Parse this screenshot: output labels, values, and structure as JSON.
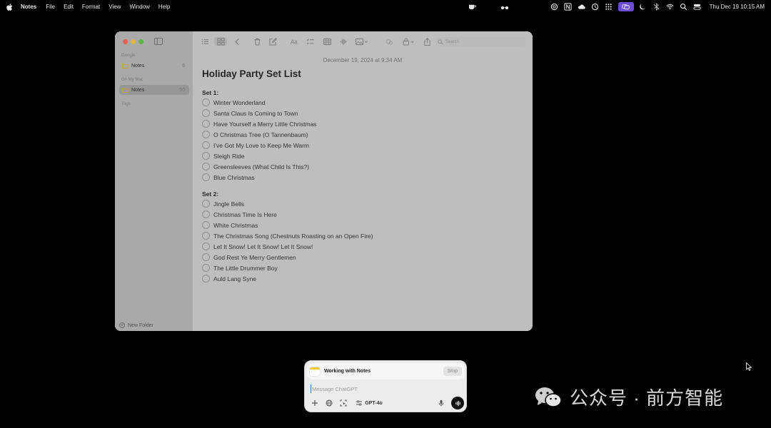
{
  "menubar": {
    "app_name": "Notes",
    "menus": [
      "File",
      "Edit",
      "Format",
      "View",
      "Window",
      "Help"
    ],
    "clock": "Thu Dec 19  10:15 AM",
    "status_icons": [
      "coffee-icon",
      "glasses-icon",
      "chatgpt-icon",
      "notion-icon",
      "cloud-icon",
      "sync-icon",
      "grid-icon",
      "screen-mirror-icon",
      "moon-icon",
      "bluetooth-icon",
      "wifi-icon",
      "search-icon",
      "control-center-icon"
    ]
  },
  "sidebar": {
    "sections": [
      {
        "label": "Google",
        "items": [
          {
            "label": "Notes",
            "count": "6"
          }
        ]
      },
      {
        "label": "On My Mac",
        "items": [
          {
            "label": "Notes",
            "count": "50",
            "selected": true
          }
        ]
      },
      {
        "label": "Tags",
        "items": []
      }
    ],
    "new_folder_label": "New Folder"
  },
  "toolbar": {
    "search_placeholder": "Search"
  },
  "note": {
    "date": "December 19, 2024 at 9:34 AM",
    "title": "Holiday Party Set List",
    "sets": [
      {
        "heading": "Set 1:",
        "items": [
          "Winter Wonderland",
          "Santa Claus Is Coming to Town",
          "Have Yourself a Merry Little Christmas",
          "O Christmas Tree (O Tannenbaum)",
          "I've Got My Love to Keep Me Warm",
          "Sleigh Ride",
          "Greensleeves (What Child Is This?)",
          "Blue Christmas"
        ]
      },
      {
        "heading": "Set 2:",
        "items": [
          "Jingle Bells",
          "Christmas Time Is Here",
          "White Christmas",
          "The Christmas Song (Chestnuts Roasting on an Open Fire)",
          "Let It Snow! Let It Snow! Let It Snow!",
          "God Rest Ye Merry Gentlemen",
          "The Little Drummer Boy",
          "Auld Lang Syne"
        ]
      }
    ]
  },
  "chatgpt": {
    "status": "Working with Notes",
    "stop_label": "Stop",
    "input_placeholder": "Message ChatGPT",
    "model_label": "GPT-4o"
  },
  "watermark": {
    "text": "公众号 · 前方智能"
  },
  "colors": {
    "desktop": "#000000",
    "traffic_red": "#e0625a",
    "traffic_yellow": "#e2b43d",
    "traffic_green": "#5fb548",
    "notes_yellow": "#f2c833"
  }
}
